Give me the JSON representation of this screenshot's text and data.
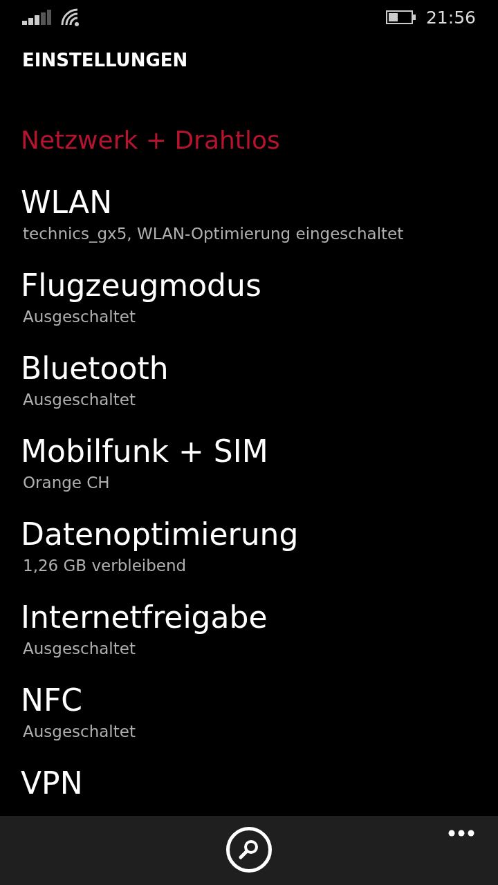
{
  "status_bar": {
    "time": "21:56"
  },
  "page_title": "EINSTELLUNGEN",
  "section_header": "Netzwerk + Drahtlos",
  "items": [
    {
      "title": "WLAN",
      "subtitle": "technics_gx5, WLAN-Optimierung eingeschaltet"
    },
    {
      "title": "Flugzeugmodus",
      "subtitle": "Ausgeschaltet"
    },
    {
      "title": "Bluetooth",
      "subtitle": "Ausgeschaltet"
    },
    {
      "title": "Mobilfunk + SIM",
      "subtitle": "Orange CH"
    },
    {
      "title": "Datenoptimierung",
      "subtitle": "1,26 GB verbleibend"
    },
    {
      "title": "Internetfreigabe",
      "subtitle": "Ausgeschaltet"
    },
    {
      "title": "NFC",
      "subtitle": "Ausgeschaltet"
    },
    {
      "title": "VPN"
    }
  ]
}
